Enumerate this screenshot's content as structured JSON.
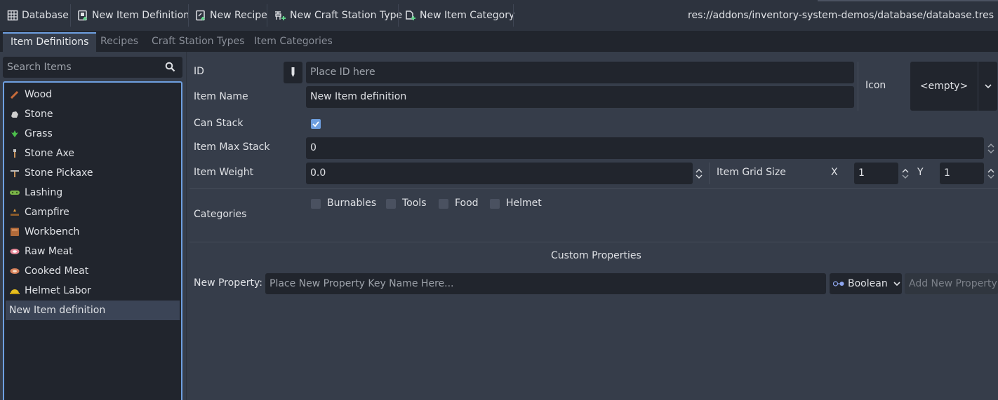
{
  "toolbar": {
    "database": "Database",
    "new_item_definition": "New Item Definition",
    "new_recipe": "New Recipe",
    "new_craft_station_type": "New Craft Station Type",
    "new_item_category": "New Item Category",
    "path": "res://addons/inventory-system-demos/database/database.tres"
  },
  "tabs": [
    "Item Definitions",
    "Recipes",
    "Craft Station Types",
    "Item Categories"
  ],
  "active_tab": "Item Definitions",
  "search": {
    "placeholder": "Search Items"
  },
  "items": [
    {
      "label": "Wood",
      "icon": "wood-icon",
      "color": "#c56a3a"
    },
    {
      "label": "Stone",
      "icon": "stone-icon",
      "color": "#cfcfcf"
    },
    {
      "label": "Grass",
      "icon": "grass-icon",
      "color": "#4cc04c"
    },
    {
      "label": "Stone Axe",
      "icon": "stone-axe-icon",
      "color": "#c9935a"
    },
    {
      "label": "Stone Pickaxe",
      "icon": "stone-pickaxe-icon",
      "color": "#c9935a"
    },
    {
      "label": "Lashing",
      "icon": "lashing-icon",
      "color": "#7ab648"
    },
    {
      "label": "Campfire",
      "icon": "campfire-icon",
      "color": "#d08a3a"
    },
    {
      "label": "Workbench",
      "icon": "workbench-icon",
      "color": "#b06a3a"
    },
    {
      "label": "Raw Meat",
      "icon": "raw-meat-icon",
      "color": "#e88a9a"
    },
    {
      "label": "Cooked Meat",
      "icon": "cooked-meat-icon",
      "color": "#d6805a"
    },
    {
      "label": "Helmet Labor",
      "icon": "helmet-labor-icon",
      "color": "#e8c020"
    },
    {
      "label": "New Item definition",
      "icon": "",
      "color": ""
    }
  ],
  "selected_item": "New Item definition",
  "form": {
    "id_label": "ID",
    "id_placeholder": "Place ID here",
    "item_name_label": "Item Name",
    "item_name_value": "New Item definition",
    "icon_label": "Icon",
    "icon_value": "<empty>",
    "can_stack_label": "Can Stack",
    "can_stack_checked": true,
    "max_stack_label": "Item Max Stack",
    "max_stack_value": "0",
    "weight_label": "Item Weight",
    "weight_value": "0.0",
    "grid_size_label": "Item Grid Size",
    "grid_x_label": "X",
    "grid_x_value": "1",
    "grid_y_label": "Y",
    "grid_y_value": "1",
    "categories_label": "Categories",
    "categories": [
      {
        "label": "Burnables",
        "checked": false
      },
      {
        "label": "Tools",
        "checked": false
      },
      {
        "label": "Food",
        "checked": false
      },
      {
        "label": "Helmet",
        "checked": false
      }
    ]
  },
  "custom_properties": {
    "title": "Custom Properties",
    "new_property_label": "New Property:",
    "key_placeholder": "Place New Property Key Name Here...",
    "type_value": "Boolean",
    "add_button": "Add New Property"
  },
  "colors": {
    "accent": "#6e9fe0",
    "background": "#363d4a",
    "field": "#21252d",
    "toolbar": "#2d333e"
  }
}
